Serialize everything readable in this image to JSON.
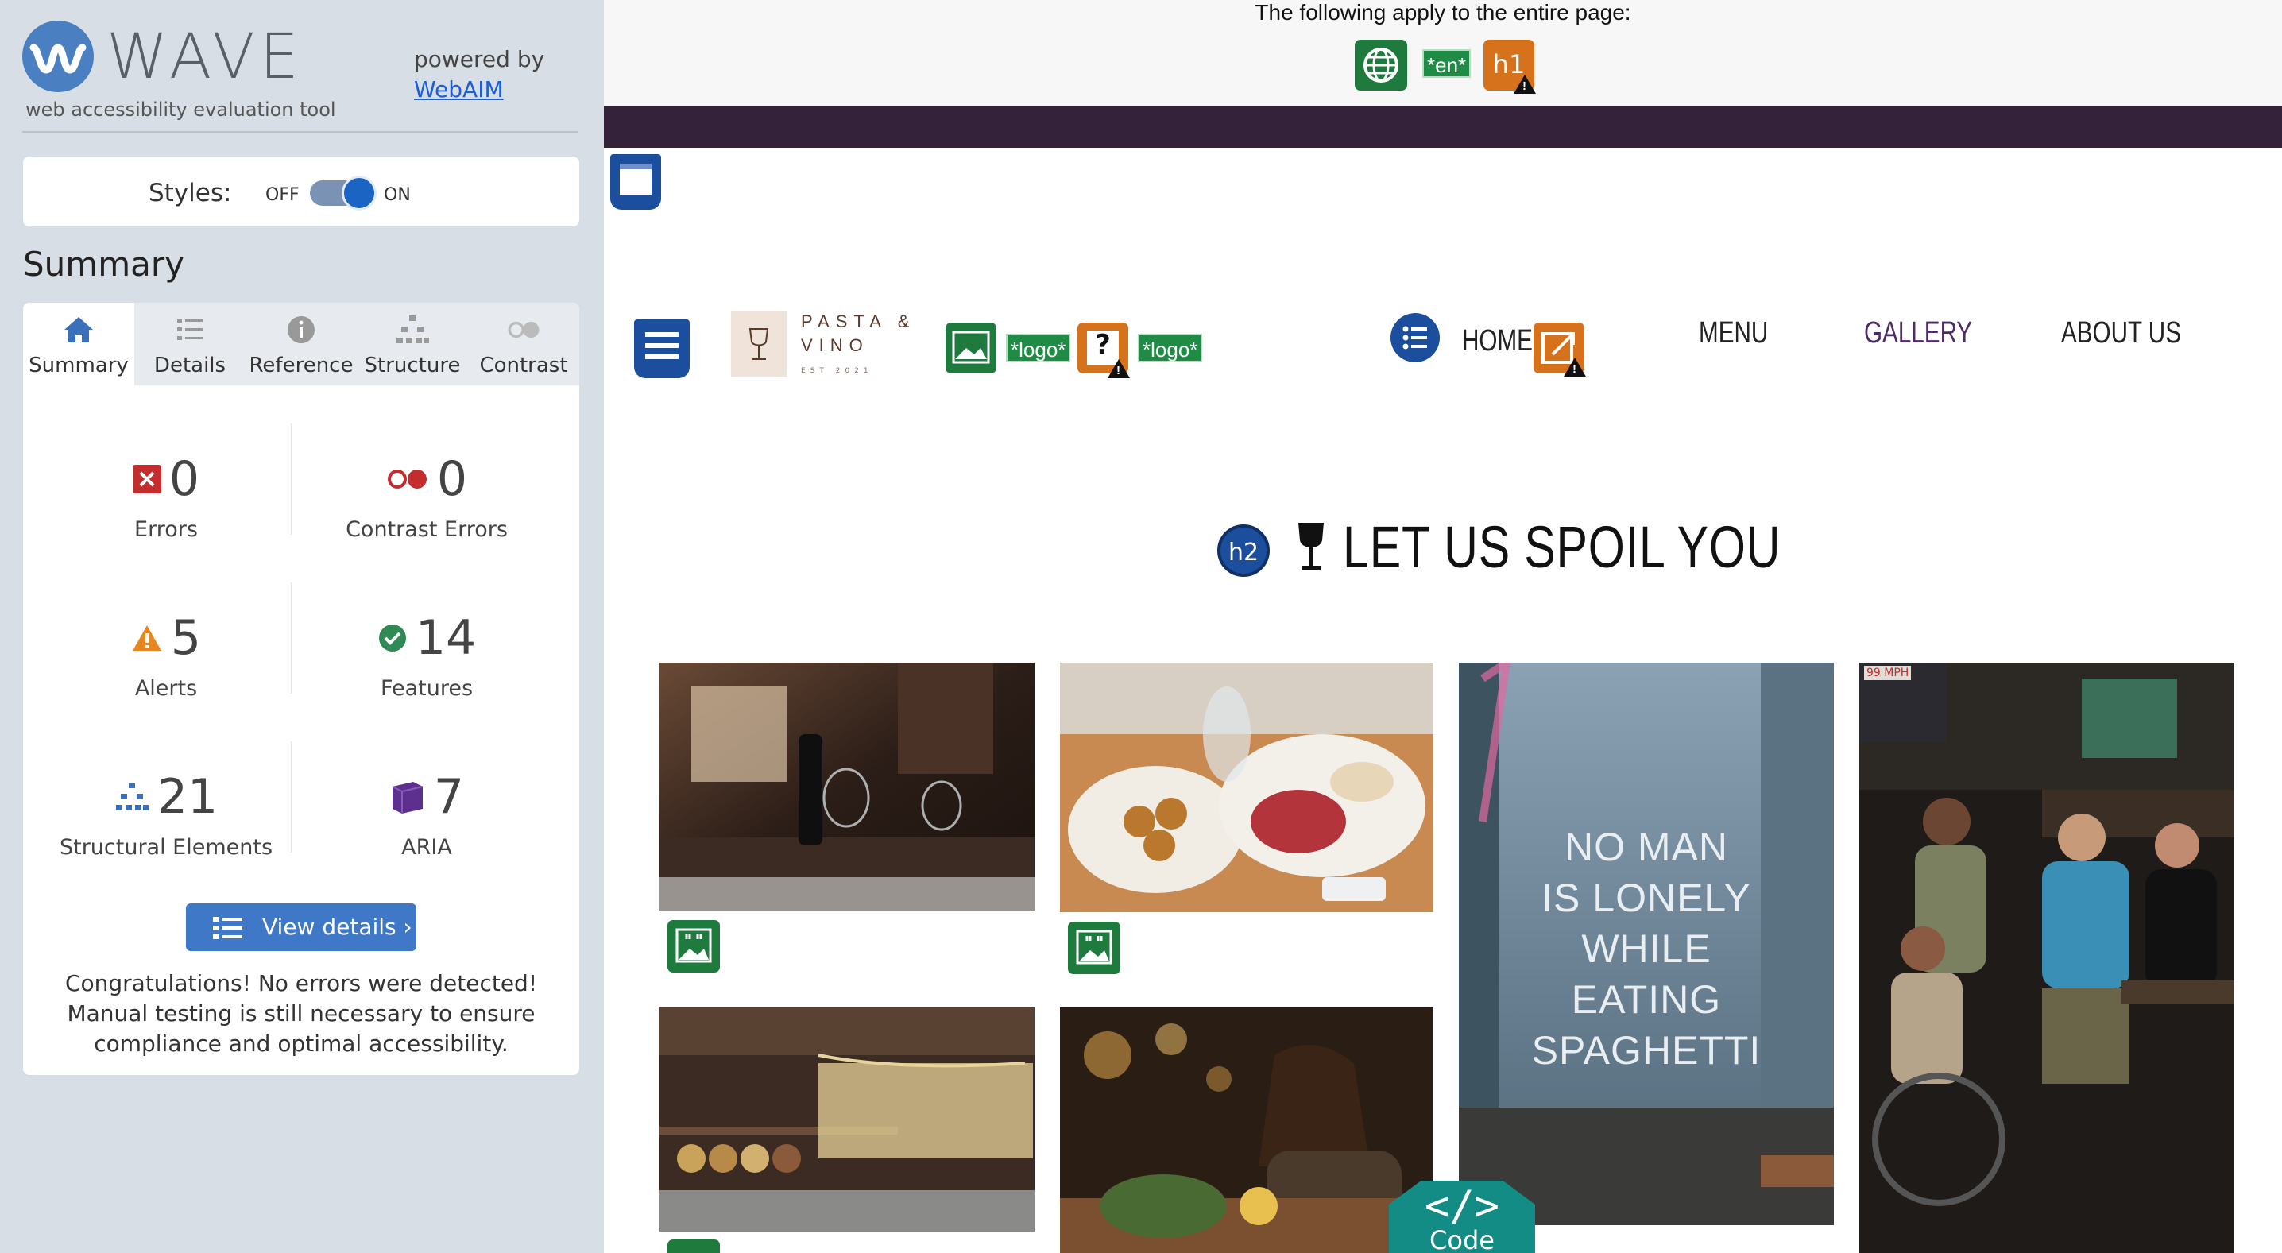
{
  "sidebar": {
    "app_name": "WAVE",
    "tagline": "web accessibility evaluation tool",
    "powered_by": "powered by",
    "webaim_link": "WebAIM",
    "styles": {
      "label": "Styles:",
      "off": "OFF",
      "on": "ON",
      "state": "on"
    },
    "summary_heading": "Summary",
    "tabs": [
      {
        "label": "Summary",
        "icon": "home-icon",
        "active": true
      },
      {
        "label": "Details",
        "icon": "list-icon"
      },
      {
        "label": "Reference",
        "icon": "info-icon"
      },
      {
        "label": "Structure",
        "icon": "hierarchy-icon"
      },
      {
        "label": "Contrast",
        "icon": "contrast-icon"
      }
    ],
    "stats": [
      {
        "value": "0",
        "label": "Errors",
        "icon": "error-icon",
        "color": "#c42d2d"
      },
      {
        "value": "0",
        "label": "Contrast Errors",
        "icon": "contrast-error-icon",
        "color": "#c42d2d"
      },
      {
        "value": "5",
        "label": "Alerts",
        "icon": "alert-icon",
        "color": "#e8861f"
      },
      {
        "value": "14",
        "label": "Features",
        "icon": "feature-check-icon",
        "color": "#2f8a55"
      },
      {
        "value": "21",
        "label": "Structural Elements",
        "icon": "structure-icon",
        "color": "#3a6fba"
      },
      {
        "value": "7",
        "label": "ARIA",
        "icon": "aria-cube-icon",
        "color": "#5d2f8f"
      }
    ],
    "view_details": "View details ›",
    "congrats": "Congratulations! No errors were detected! Manual testing is still necessary to ensure compliance and optimal accessibility."
  },
  "page": {
    "banner_text": "The following apply to the entire page:",
    "lang_tag": "*en*",
    "h1_tag": "h1",
    "brand": {
      "line1": "PASTA &",
      "line2": "VINO",
      "est": "EST 2021"
    },
    "logo_tag": "*logo*",
    "question_mark": "?",
    "nav": [
      {
        "label": "HOME"
      },
      {
        "label": "MENU"
      },
      {
        "label": "GALLERY"
      },
      {
        "label": "ABOUT US"
      }
    ],
    "h2_tag": "h2",
    "section_title": "LET US SPOIL YOU",
    "poster_text": [
      "NO MAN",
      "IS LONELY",
      "WHILE",
      "EATING",
      "SPAGHETTI"
    ],
    "mph_sign": "99 MPH",
    "code_button": {
      "glyph": "</>",
      "label": "Code"
    }
  },
  "colors": {
    "sidebar_bg": "#d8dee5",
    "accent_blue": "#3f78c7",
    "feature_green": "#1e7a3d",
    "alert_orange": "#d6711c",
    "structure_blue": "#1b4e9c",
    "header_purple": "#33223a",
    "code_teal": "#138c86"
  }
}
